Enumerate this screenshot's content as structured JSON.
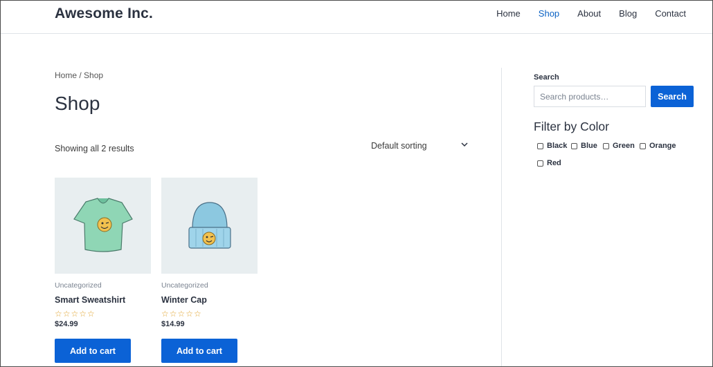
{
  "header": {
    "logo": "Awesome Inc.",
    "nav": [
      "Home",
      "Shop",
      "About",
      "Blog",
      "Contact"
    ],
    "active": "Shop"
  },
  "breadcrumb": "Home / Shop",
  "page_title": "Shop",
  "results_text": "Showing all 2 results",
  "sorting": {
    "selected": "Default sorting"
  },
  "products": [
    {
      "category": "Uncategorized",
      "name": "Smart Sweatshirt",
      "rating": 0,
      "stars": "☆☆☆☆☆",
      "price": "$24.99",
      "button": "Add to cart"
    },
    {
      "category": "Uncategorized",
      "name": "Winter Cap",
      "rating": 0,
      "stars": "☆☆☆☆☆",
      "price": "$14.99",
      "button": "Add to cart"
    }
  ],
  "sidebar": {
    "search_label": "Search",
    "search_placeholder": "Search products…",
    "search_button": "Search",
    "filter_title": "Filter by Color",
    "colors": [
      "Black",
      "Blue",
      "Green",
      "Orange",
      "Red"
    ]
  },
  "colors": {
    "accent": "#0b62d6",
    "text": "#2b3240",
    "star": "#e0a22a"
  }
}
